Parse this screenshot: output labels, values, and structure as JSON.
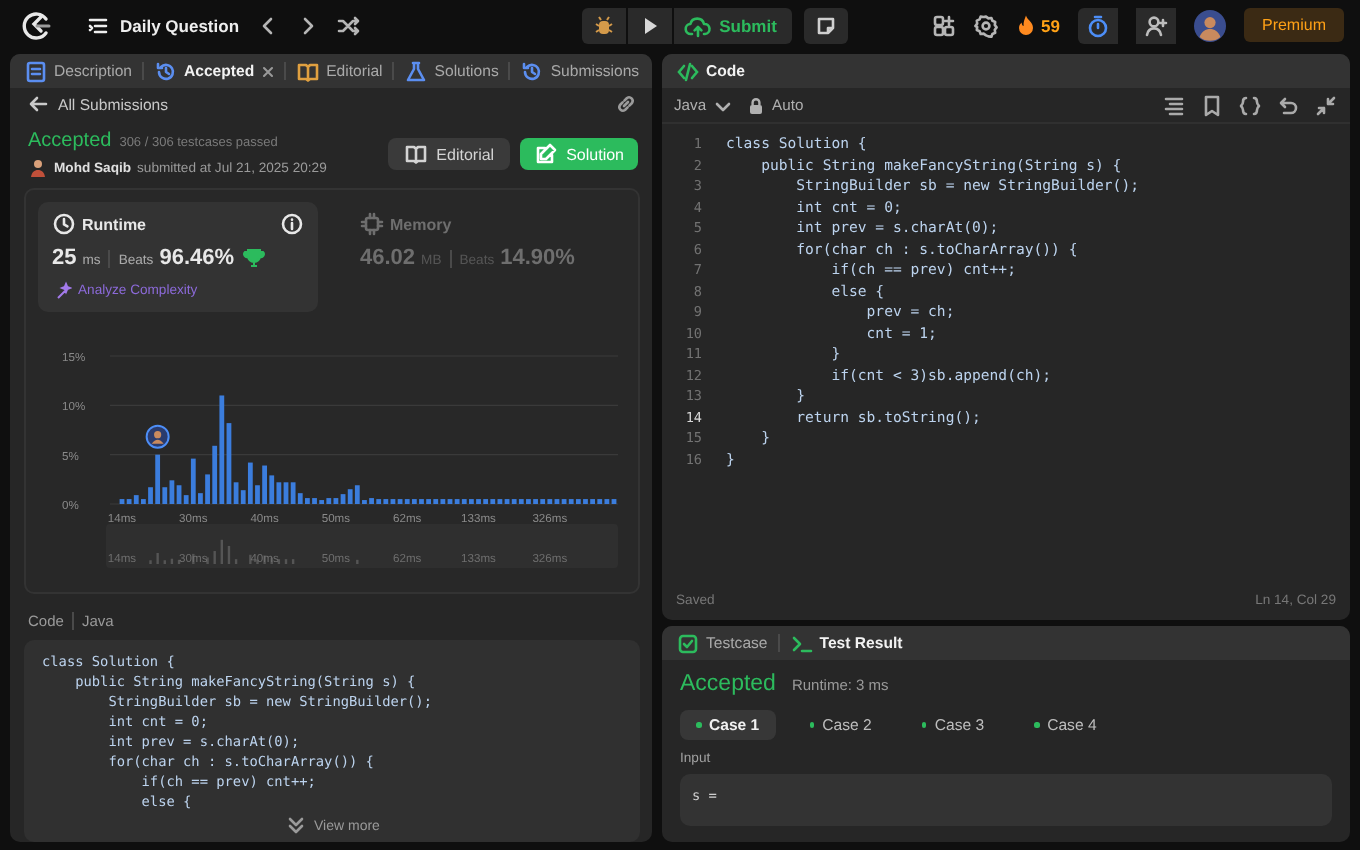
{
  "topbar": {
    "title": "Daily Question",
    "submit": "Submit",
    "streak": "59",
    "premium": "Premium"
  },
  "left_tabs": [
    {
      "label": "Description",
      "selected": false,
      "closable": false
    },
    {
      "label": "Accepted",
      "selected": true,
      "closable": true
    },
    {
      "label": "Editorial",
      "selected": false,
      "closable": false
    },
    {
      "label": "Solutions",
      "selected": false,
      "closable": false
    },
    {
      "label": "Submissions",
      "selected": false,
      "closable": false
    }
  ],
  "submission": {
    "back": "All Submissions",
    "status": "Accepted",
    "testcases": "306 / 306 testcases passed",
    "author": "Mohd Saqib",
    "submitted": "submitted at Jul 21, 2025 20:29",
    "buttons": [
      {
        "label": "Editorial",
        "kind": "secondary"
      },
      {
        "label": "Solution",
        "kind": "primary"
      }
    ]
  },
  "metrics": [
    {
      "title": "Runtime",
      "value": "25",
      "unit": "ms",
      "beats_label": "Beats",
      "beats": "96.46%",
      "selected": true,
      "link": "Analyze Complexity"
    },
    {
      "title": "Memory",
      "value": "46.02",
      "unit": "MB",
      "beats_label": "Beats",
      "beats": "14.90%",
      "selected": false
    }
  ],
  "chart_data": {
    "type": "bar",
    "ylim": [
      0,
      15
    ],
    "yticks": [
      {
        "value": 0,
        "label": "0%"
      },
      {
        "value": 5,
        "label": "5%"
      },
      {
        "value": 10,
        "label": "10%"
      },
      {
        "value": 15,
        "label": "15%"
      }
    ],
    "categories": [
      "14ms",
      null,
      null,
      null,
      null,
      null,
      null,
      null,
      null,
      null,
      "30ms",
      null,
      null,
      null,
      null,
      null,
      null,
      null,
      null,
      null,
      "40ms",
      null,
      null,
      null,
      null,
      null,
      null,
      null,
      null,
      null,
      "50ms",
      null,
      null,
      null,
      null,
      null,
      null,
      null,
      null,
      null,
      "62ms",
      null,
      null,
      null,
      null,
      null,
      null,
      null,
      null,
      null,
      "133ms",
      null,
      null,
      null,
      null,
      null,
      null,
      null,
      null,
      null,
      "326ms",
      null,
      null,
      null,
      null,
      null,
      null,
      null,
      null,
      null
    ],
    "series": [
      {
        "color": "#3b7ddd",
        "values": [
          0.5,
          0.5,
          0.9,
          0.5,
          1.7,
          5,
          1.7,
          2.4,
          1.9,
          0.9,
          4.6,
          1.1,
          3,
          5.9,
          11,
          8.2,
          2.2,
          1.4,
          4.2,
          1.9,
          3.9,
          2.9,
          2.2,
          2.2,
          2.2,
          1.1,
          0.6,
          0.6,
          0.4,
          0.6,
          0.6,
          1,
          1.5,
          1.9,
          0.4,
          0.6,
          0.5,
          0.5,
          0.5,
          0.5,
          0.5,
          0.5,
          0.5,
          0.5,
          0.5,
          0.5,
          0.5,
          0.5,
          0.5,
          0.5,
          0.5,
          0.5,
          0.5,
          0.5,
          0.5,
          0.5,
          0.5,
          0.5,
          0.5,
          0.5,
          0.5,
          0.5,
          0.5,
          0.5,
          0.5,
          0.5,
          0.5,
          0.5,
          0.5,
          0.5
        ]
      }
    ]
  },
  "range_labels": [
    "14ms",
    "30ms",
    "40ms",
    "50ms",
    "62ms",
    "133ms",
    "326ms"
  ],
  "code_preview": {
    "label": "Code",
    "language": "Java",
    "more": "View more",
    "lines": [
      "class Solution {",
      "    public String makeFancyString(String s) {",
      "        StringBuilder sb = new StringBuilder();",
      "        int cnt = 0;",
      "        int prev = s.charAt(0);",
      "        for(char ch : s.toCharArray()) {",
      "            if(ch == prev) cnt++;",
      "            else {"
    ]
  },
  "editor": {
    "title": "Code",
    "language": "Java",
    "mode": "Auto",
    "status": "Saved",
    "cursor": "Ln 14, Col 29",
    "lines": [
      {
        "number": "1",
        "text": "class Solution {",
        "active": false
      },
      {
        "number": "2",
        "text": "    public String makeFancyString(String s) {",
        "active": false
      },
      {
        "number": "3",
        "text": "        StringBuilder sb = new StringBuilder();",
        "active": false
      },
      {
        "number": "4",
        "text": "        int cnt = 0;",
        "active": false
      },
      {
        "number": "5",
        "text": "        int prev = s.charAt(0);",
        "active": false
      },
      {
        "number": "6",
        "text": "        for(char ch : s.toCharArray()) {",
        "active": false
      },
      {
        "number": "7",
        "text": "            if(ch == prev) cnt++;",
        "active": false
      },
      {
        "number": "8",
        "text": "            else {",
        "active": false
      },
      {
        "number": "9",
        "text": "                prev = ch;",
        "active": false
      },
      {
        "number": "10",
        "text": "                cnt = 1;",
        "active": false
      },
      {
        "number": "11",
        "text": "            }",
        "active": false
      },
      {
        "number": "12",
        "text": "            if(cnt < 3)sb.append(ch);",
        "active": false
      },
      {
        "number": "13",
        "text": "        }",
        "active": false
      },
      {
        "number": "14",
        "text": "        return sb.toString();",
        "active": true
      },
      {
        "number": "15",
        "text": "    }",
        "active": false
      },
      {
        "number": "16",
        "text": "}",
        "active": false
      }
    ]
  },
  "result": {
    "tabs": [
      {
        "label": "Testcase",
        "selected": false
      },
      {
        "label": "Test Result",
        "selected": true
      }
    ],
    "status": "Accepted",
    "runtime": "Runtime: 3 ms",
    "cases": [
      {
        "label": "Case 1",
        "selected": true
      },
      {
        "label": "Case 2",
        "selected": false
      },
      {
        "label": "Case 3",
        "selected": false
      },
      {
        "label": "Case 4",
        "selected": false
      }
    ],
    "input_label": "Input",
    "input_lines": [
      "s ="
    ]
  }
}
